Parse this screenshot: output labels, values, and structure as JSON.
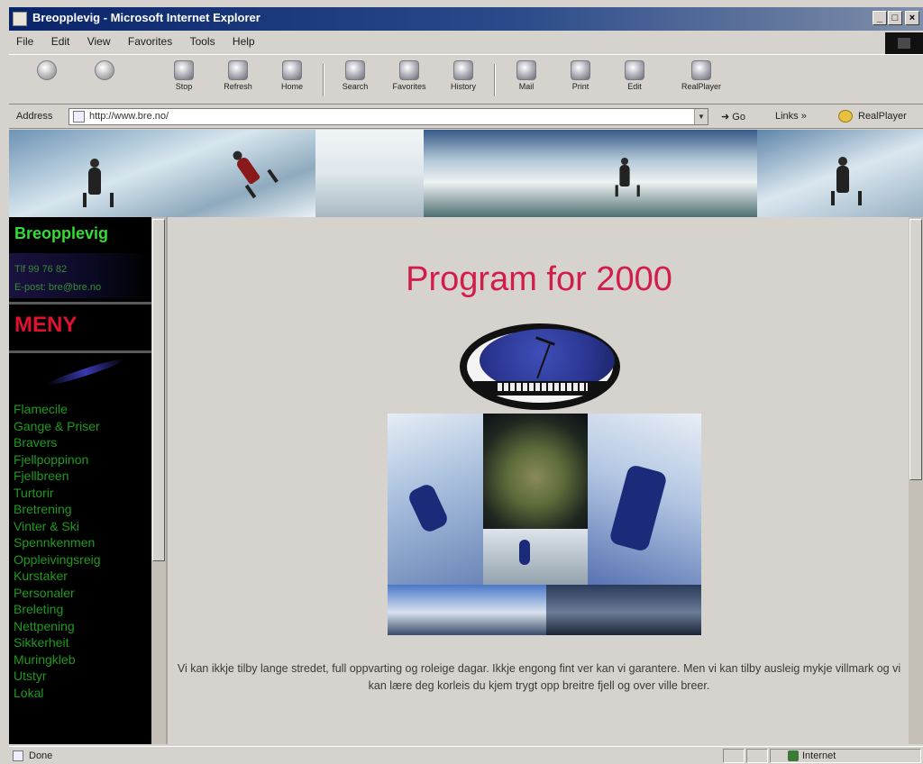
{
  "window": {
    "title": "Breopplevig - Microsoft Internet Explorer",
    "controls": [
      "_",
      "□",
      "×"
    ]
  },
  "menu": [
    "File",
    "Edit",
    "View",
    "Favorites",
    "Tools",
    "Help"
  ],
  "toolbar": {
    "buttons": [
      {
        "label": "",
        "icon": "back-arrow-icon"
      },
      {
        "label": "",
        "icon": "forward-arrow-icon"
      },
      {
        "label": "Stop",
        "icon": "stop-icon"
      },
      {
        "label": "Refresh",
        "icon": "refresh-icon"
      },
      {
        "label": "Home",
        "icon": "home-icon"
      },
      {
        "label": "Search",
        "icon": "search-icon"
      },
      {
        "label": "Favorites",
        "icon": "favorites-icon"
      },
      {
        "label": "History",
        "icon": "history-icon"
      },
      {
        "label": "Mail",
        "icon": "mail-icon"
      },
      {
        "label": "Print",
        "icon": "print-icon"
      },
      {
        "label": "Edit",
        "icon": "edit-icon"
      },
      {
        "label": "RealPlayer",
        "icon": "realplayer-icon"
      }
    ]
  },
  "address": {
    "label": "Address",
    "url": "http://www.bre.no/",
    "go_label": "Go",
    "links_label": "Links",
    "realplayer_label": "RealPlayer"
  },
  "sidebar": {
    "site_title": "Breopplevig",
    "contact_phone": "Tlf 99 76 82",
    "contact_email": "E-post: bre@bre.no",
    "menu_title": "MENY",
    "items": [
      "Flamecile",
      "Gange & Priser",
      "Bravers",
      "Fjellpoppinon",
      "Fjellbreen",
      "Turtorir",
      "Bretrening",
      "Vinter & Ski",
      "Spennkenmen",
      "Oppleivingsreig",
      "Kurstaker",
      "Personaler",
      "Breleting",
      "Nettpening",
      "Sikkerheit",
      "Muringkleb",
      "Utstyr",
      "Lokal"
    ]
  },
  "content": {
    "title": "Program for 2000",
    "intro": "Vi kan ikkje tilby lange stredet, full oppvarting og roleige dagar. Ikkje engong fint ver kan vi garantere. Men vi kan tilby ausleig mykje villmark og vi kan lære deg korleis du kjem trygt opp breitre fjell og over ville breer."
  },
  "status": {
    "text": "Done",
    "zone": "Internet"
  }
}
